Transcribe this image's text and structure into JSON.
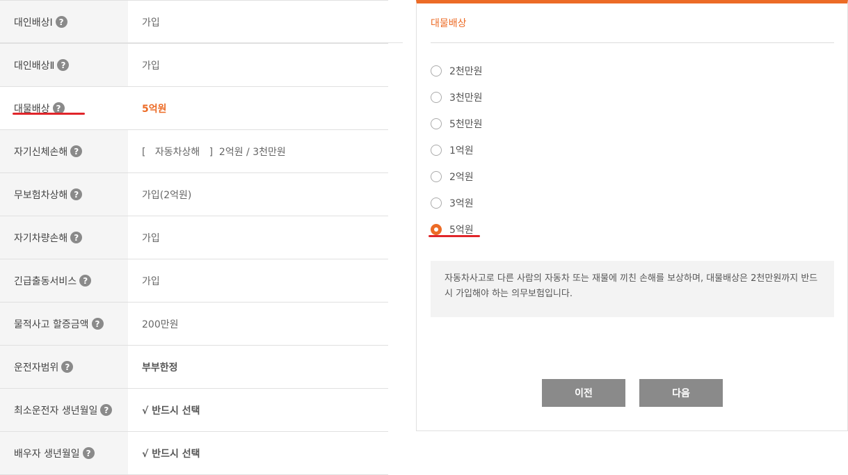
{
  "table": {
    "rows": [
      {
        "label": "대인배상Ⅰ",
        "value": "가입",
        "style": "normal"
      },
      {
        "label": "대인배상Ⅱ",
        "value": "가입",
        "style": "normal"
      },
      {
        "label": "대물배상",
        "value": "5억원",
        "style": "orange"
      },
      {
        "label": "자기신체손해",
        "value": "[   자동차상해   ]  2억원 / 3천만원",
        "style": "normal"
      },
      {
        "label": "무보험차상해",
        "value": "가입(2억원)",
        "style": "normal"
      },
      {
        "label": "자기차량손해",
        "value": "가입",
        "style": "normal"
      },
      {
        "label": "긴급출동서비스",
        "value": "가입",
        "style": "normal"
      },
      {
        "label": "물적사고 할증금액",
        "value": "200만원",
        "style": "normal"
      },
      {
        "label": "운전자범위",
        "value": "부부한정",
        "style": "bold"
      },
      {
        "label": "최소운전자 생년월일",
        "value": "√ 반드시 선택",
        "style": "bold"
      },
      {
        "label": "배우자 생년월일",
        "value": "√ 반드시 선택",
        "style": "bold"
      }
    ],
    "help_icon": "?"
  },
  "panel": {
    "title": "대물배상",
    "options": [
      "2천만원",
      "3천만원",
      "5천만원",
      "1억원",
      "2억원",
      "3억원",
      "5억원"
    ],
    "selected": "5억원",
    "description": "자동차사고로 다른 사람의 자동차 또는 재물에 끼친 손해를 보상하며, 대물배상은 2천만원까지 반드시 가입해야 하는 의무보험입니다.",
    "prev_label": "이전",
    "next_label": "다음"
  },
  "colors": {
    "accent": "#ec6b26",
    "highlight_underline": "#e0252a",
    "button": "#8a8a8a"
  }
}
